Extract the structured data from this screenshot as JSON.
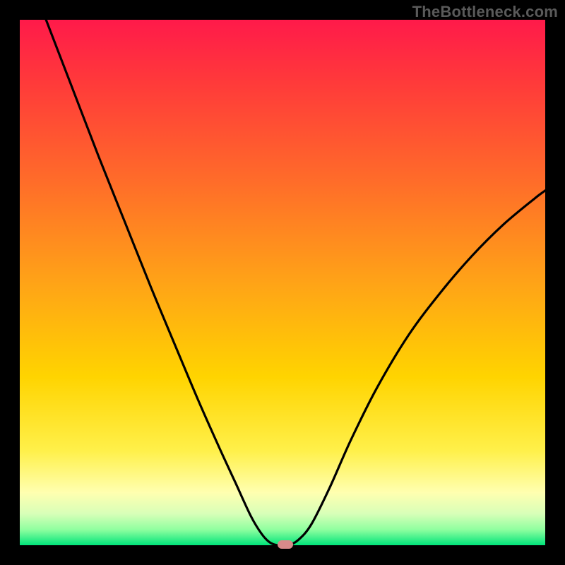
{
  "watermark": "TheBottleneck.com",
  "chart_data": {
    "type": "line",
    "title": "",
    "xlabel": "",
    "ylabel": "",
    "x_range": [
      0,
      1
    ],
    "y_range": [
      0,
      1
    ],
    "series": [
      {
        "name": "curve",
        "points": [
          {
            "x": 0.05,
            "y": 1.0
          },
          {
            "x": 0.1,
            "y": 0.87
          },
          {
            "x": 0.15,
            "y": 0.74
          },
          {
            "x": 0.2,
            "y": 0.615
          },
          {
            "x": 0.25,
            "y": 0.49
          },
          {
            "x": 0.3,
            "y": 0.37
          },
          {
            "x": 0.34,
            "y": 0.275
          },
          {
            "x": 0.38,
            "y": 0.185
          },
          {
            "x": 0.41,
            "y": 0.12
          },
          {
            "x": 0.44,
            "y": 0.055
          },
          {
            "x": 0.46,
            "y": 0.022
          },
          {
            "x": 0.475,
            "y": 0.006
          },
          {
            "x": 0.49,
            "y": 0.0
          },
          {
            "x": 0.51,
            "y": 0.0
          },
          {
            "x": 0.53,
            "y": 0.01
          },
          {
            "x": 0.555,
            "y": 0.04
          },
          {
            "x": 0.59,
            "y": 0.11
          },
          {
            "x": 0.63,
            "y": 0.2
          },
          {
            "x": 0.68,
            "y": 0.3
          },
          {
            "x": 0.74,
            "y": 0.4
          },
          {
            "x": 0.8,
            "y": 0.48
          },
          {
            "x": 0.86,
            "y": 0.55
          },
          {
            "x": 0.92,
            "y": 0.61
          },
          {
            "x": 0.98,
            "y": 0.66
          },
          {
            "x": 1.0,
            "y": 0.675
          }
        ]
      }
    ],
    "marker": {
      "x": 0.505,
      "y": 0.002
    },
    "colors": {
      "gradient_top": "#ff1a4a",
      "gradient_bottom": "#00e47a",
      "curve": "#000000",
      "marker": "#d88a8a",
      "frame": "#000000"
    }
  }
}
